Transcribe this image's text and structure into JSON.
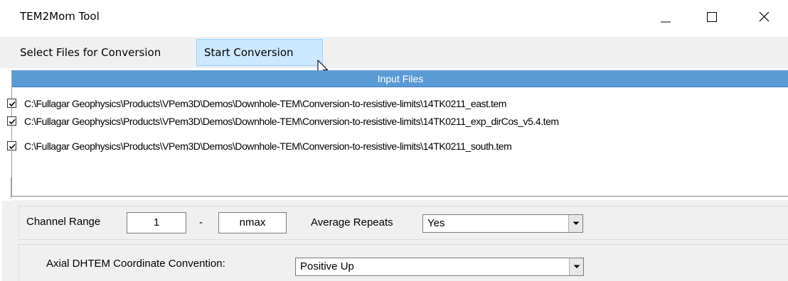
{
  "window": {
    "title": "TEM2Mom Tool",
    "minimize_icon": "minimize-icon",
    "maximize_icon": "maximize-icon",
    "close_icon": "close-icon"
  },
  "menu": {
    "select_files_label": "Select Files for Conversion",
    "start_conversion_label": "Start Conversion"
  },
  "input_files": {
    "header": "Input Files",
    "files": [
      {
        "checked": true,
        "path": "C:\\Fullagar Geophysics\\Products\\VPem3D\\Demos\\Downhole-TEM\\Conversion-to-resistive-limits\\14TK0211_east.tem"
      },
      {
        "checked": true,
        "path": "C:\\Fullagar Geophysics\\Products\\VPem3D\\Demos\\Downhole-TEM\\Conversion-to-resistive-limits\\14TK0211_exp_dirCos_v5.4.tem"
      },
      {
        "checked": true,
        "path": "C:\\Fullagar Geophysics\\Products\\VPem3D\\Demos\\Downhole-TEM\\Conversion-to-resistive-limits\\14TK0211_south.tem"
      }
    ]
  },
  "params": {
    "channel_range_label": "Channel Range",
    "channel_start": "1",
    "range_separator": "-",
    "channel_end": "nmax",
    "average_repeats_label": "Average Repeats",
    "average_repeats_value": "Yes",
    "axial_convention_label": "Axial DHTEM Coordinate Convention:",
    "axial_convention_value": "Positive Up"
  },
  "colors": {
    "header_blue": "#5b9bd5",
    "menu_highlight": "#cce8ff",
    "panel_bg": "#f0f0f0"
  }
}
